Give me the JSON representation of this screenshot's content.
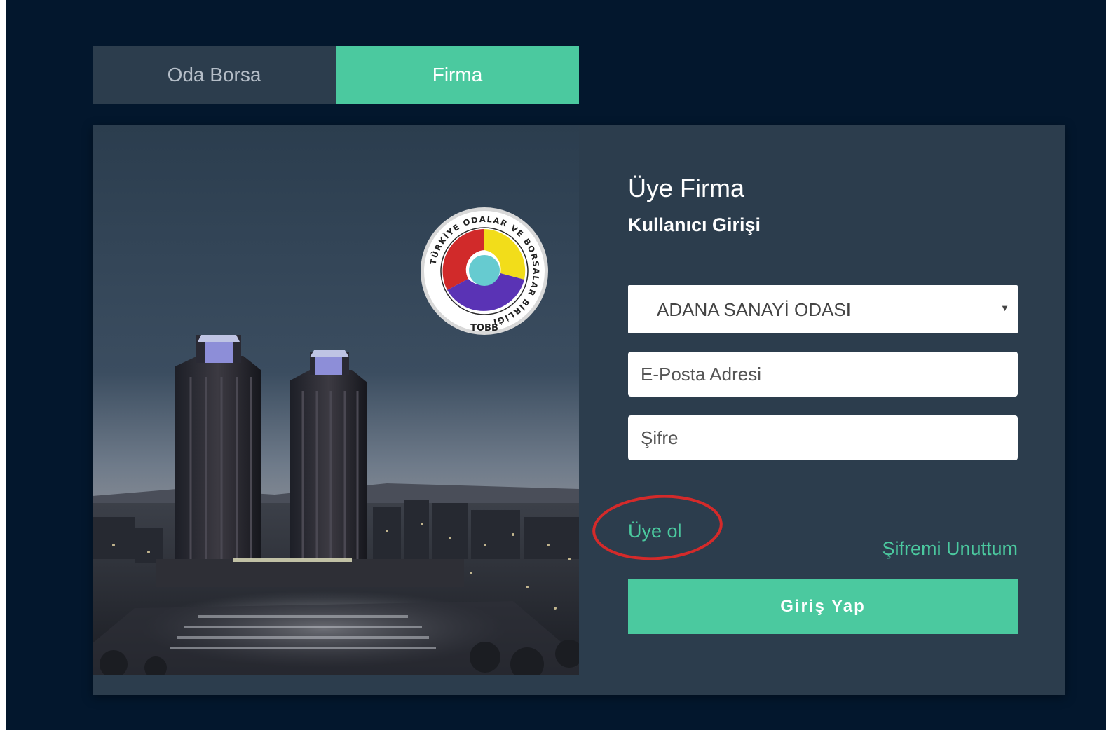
{
  "tabs": [
    {
      "label": "Oda Borsa",
      "active": false
    },
    {
      "label": "Firma",
      "active": true
    }
  ],
  "form": {
    "title": "Üye Firma",
    "subtitle": "Kullanıcı Girişi",
    "chamber_select": {
      "value": "ADANA SANAYİ ODASI"
    },
    "email": {
      "placeholder": "E-Posta Adresi"
    },
    "password": {
      "placeholder": "Şifre"
    },
    "register_link": "Üye ol",
    "forgot_link": "Şifremi Unuttum",
    "submit_label": "Giriş Yap"
  },
  "logo": {
    "text_ring": "TÜRKİYE ODALAR VE BORSALAR BİRLİĞİ",
    "abbr": "TOBB"
  },
  "colors": {
    "page_bg": "#03172d",
    "card_bg": "#2c3d4d",
    "accent": "#4bc99f",
    "annotation": "#d42a2a"
  }
}
